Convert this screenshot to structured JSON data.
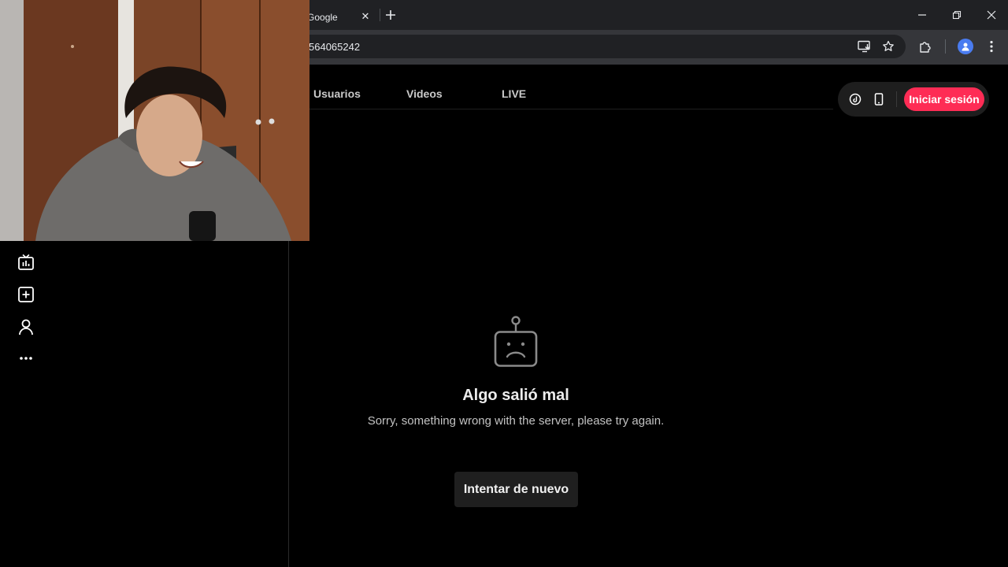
{
  "browser": {
    "tab_title": "n Google",
    "tab_close": "✕",
    "new_tab": "+",
    "url": "564065242",
    "window": {
      "minimize": "—",
      "restore": "❐",
      "close": "✕"
    }
  },
  "nav": {
    "tabs": [
      {
        "label": "Usuarios"
      },
      {
        "label": "Videos"
      },
      {
        "label": "LIVE"
      }
    ]
  },
  "header": {
    "login_label": "Iniciar sesión"
  },
  "sidebar": {
    "icons": [
      "live-tv-icon",
      "upload-icon",
      "profile-icon",
      "more-icon"
    ],
    "more_glyph": "···"
  },
  "error": {
    "title": "Algo salió mal",
    "description": "Sorry, something wrong with the server, please try again.",
    "retry_label": "Intentar de nuevo"
  },
  "colors": {
    "accent": "#fe2c55",
    "background": "#000000",
    "browser_chrome": "#202124"
  }
}
